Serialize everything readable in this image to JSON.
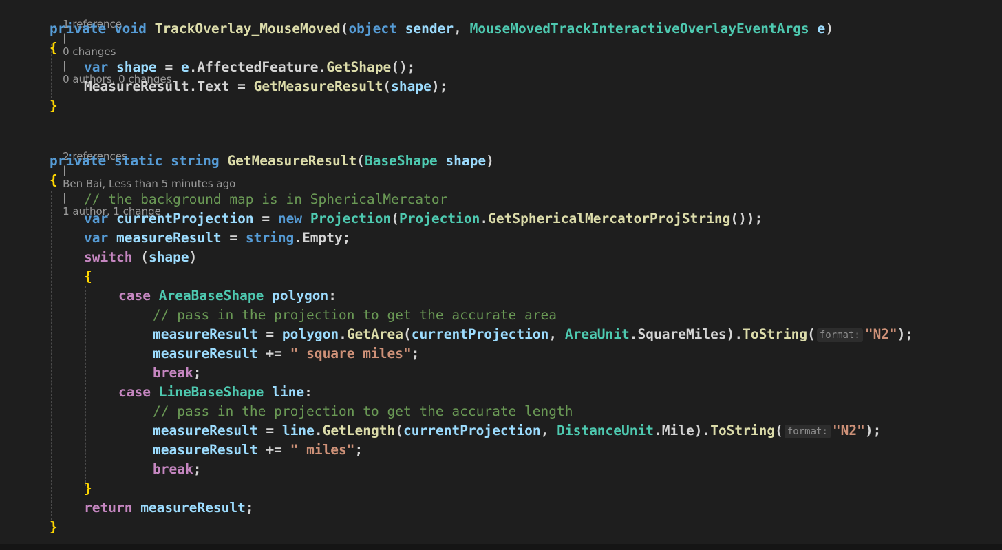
{
  "codelens": {
    "first": {
      "references": "1 reference",
      "changes": "0 changes",
      "authors": "0 authors, 0 changes"
    },
    "second": {
      "references": "2 references",
      "author": "Ben Bai, Less than 5 minutes ago",
      "changes": "1 author, 1 change"
    },
    "separator": "|"
  },
  "code": {
    "method1": {
      "kw_private": "private",
      "kw_void": "void",
      "name": "TrackOverlay_MouseMoved",
      "open_paren": "(",
      "kw_object": "object",
      "param_sender": "sender",
      "comma": ",",
      "type_args": "MouseMovedTrackInteractiveOverlayEventArgs",
      "param_e": "e",
      "close_paren": ")",
      "open_brace": "{",
      "close_brace": "}",
      "line1": {
        "kw_var": "var",
        "var_shape": "shape",
        "eq": "=",
        "e": "e",
        "member": ".AffectedFeature.",
        "call": "GetShape",
        "end": "();"
      },
      "line2": {
        "target": "MeasureResult",
        "member": ".Text",
        "eq": "=",
        "call": "GetMeasureResult",
        "open": "(",
        "arg": "shape",
        "end": ");"
      }
    },
    "method2": {
      "kw_private": "private",
      "kw_static": "static",
      "kw_string": "string",
      "name": "GetMeasureResult",
      "open_paren": "(",
      "param_type": "BaseShape",
      "param_name": "shape",
      "close_paren": ")",
      "open_brace": "{",
      "close_brace": "}",
      "comment1": "// the background map is in SphericalMercator",
      "proj_line": {
        "kw_var": "var",
        "var_name": "currentProjection",
        "eq": "=",
        "kw_new": "new",
        "type": "Projection",
        "open": "(",
        "type2": "Projection",
        "dot": ".",
        "call": "GetSphericalMercatorProjString",
        "end": "());"
      },
      "result_line": {
        "kw_var": "var",
        "var_name": "measureResult",
        "eq": "=",
        "kw_string": "string",
        "member": ".Empty;"
      },
      "switch_line": {
        "kw_switch": "switch",
        "open": "(",
        "arg": "shape",
        "close": ")"
      },
      "switch_open": "{",
      "switch_close": "}",
      "case1": {
        "kw_case": "case",
        "type": "AreaBaseShape",
        "var": "polygon",
        "colon": ":",
        "comment": "// pass in the projection to get the accurate area",
        "assign_target": "measureResult",
        "eq": "=",
        "obj": "polygon",
        "dot": ".",
        "call": "GetArea",
        "open": "(",
        "arg1": "currentProjection",
        "comma": ",",
        "enum_type": "AreaUnit",
        "enum_member": ".SquareMiles)",
        "dot2": ".",
        "call2": "ToString",
        "open2": "(",
        "hint": "format:",
        "str": "\"N2\"",
        "end": ");",
        "append_target": "measureResult",
        "append_op": "+=",
        "append_str": "\" square miles\"",
        "append_end": ";",
        "kw_break": "break",
        "break_end": ";"
      },
      "case2": {
        "kw_case": "case",
        "type": "LineBaseShape",
        "var": "line",
        "colon": ":",
        "comment": "// pass in the projection to get the accurate length",
        "assign_target": "measureResult",
        "eq": "=",
        "obj": "line",
        "dot": ".",
        "call": "GetLength",
        "open": "(",
        "arg1": "currentProjection",
        "comma": ",",
        "enum_type": "DistanceUnit",
        "enum_member": ".Mile)",
        "dot2": ".",
        "call2": "ToString",
        "open2": "(",
        "hint": "format:",
        "str": "\"N2\"",
        "end": ");",
        "append_target": "measureResult",
        "append_op": "+=",
        "append_str": "\" miles\"",
        "append_end": ";",
        "kw_break": "break",
        "break_end": ";"
      },
      "return_line": {
        "kw_return": "return",
        "var": "measureResult",
        "end": ";"
      }
    }
  }
}
